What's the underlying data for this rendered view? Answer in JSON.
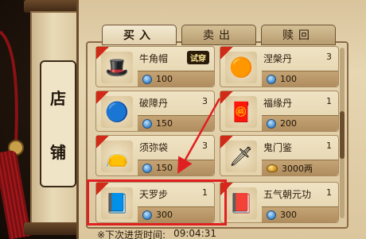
{
  "left_title": [
    "店",
    "铺"
  ],
  "tabs": [
    {
      "label": "买入",
      "active": true
    },
    {
      "label": "卖出",
      "active": false
    },
    {
      "label": "赎回",
      "active": false
    }
  ],
  "items": [
    {
      "name": "牛角帽",
      "count": "",
      "badge": "试穿",
      "price": "100",
      "currency": "coin",
      "icon": "horned-hat-icon",
      "glyph": "🎩"
    },
    {
      "name": "涅槃丹",
      "count": "3",
      "badge": "",
      "price": "100",
      "currency": "coin",
      "icon": "pill-icon",
      "glyph": "🟠"
    },
    {
      "name": "破障丹",
      "count": "3",
      "badge": "",
      "price": "150",
      "currency": "coin",
      "icon": "blue-pill-icon",
      "glyph": "🔵"
    },
    {
      "name": "福缘丹",
      "count": "1",
      "badge": "",
      "price": "200",
      "currency": "coin",
      "icon": "fortune-pill-icon",
      "glyph": "🧧"
    },
    {
      "name": "须弥袋",
      "count": "3",
      "badge": "",
      "price": "150",
      "currency": "coin",
      "icon": "bag-icon",
      "glyph": "👝"
    },
    {
      "name": "鬼门鉴",
      "count": "1",
      "badge": "",
      "price": "3000两",
      "currency": "gold",
      "icon": "mirror-icon",
      "glyph": "🗡"
    },
    {
      "name": "天罗步",
      "count": "1",
      "badge": "",
      "price": "300",
      "currency": "coin",
      "icon": "skill-book-icon",
      "glyph": "📘"
    },
    {
      "name": "五气朝元功",
      "count": "1",
      "badge": "",
      "price": "300",
      "currency": "coin",
      "icon": "skill-book-red-icon",
      "glyph": "📕"
    }
  ],
  "footer": {
    "label": "※下次进货时间:",
    "time": "09:04:31"
  },
  "colors": {
    "highlight": "#e02020",
    "arrow": "#e02020"
  }
}
